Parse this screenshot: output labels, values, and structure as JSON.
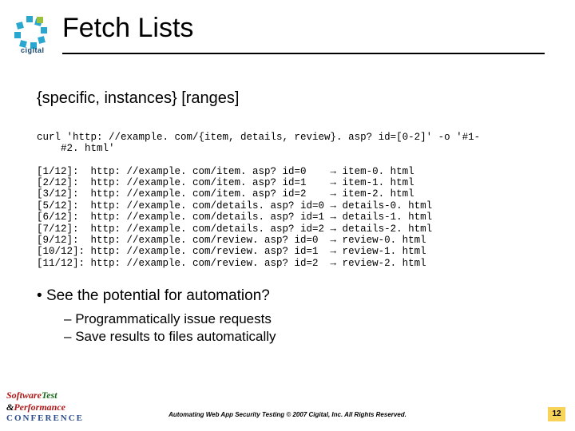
{
  "brand": {
    "name": "cigital",
    "logo_color_primary": "#2aa7cf",
    "logo_color_accent": "#9ac23c"
  },
  "title": "Fetch Lists",
  "subtitle": "{specific, instances} [ranges]",
  "code": {
    "cmd": "curl 'http: //example. com/{item, details, review}. asp? id=[0-2]' -o '#1-\n    #2. html'",
    "rows": [
      {
        "idx": "[1/12]:",
        "url": "http: //example. com/item. asp? id=0",
        "arrow": "→",
        "out": "item-0. html"
      },
      {
        "idx": "[2/12]:",
        "url": "http: //example. com/item. asp? id=1",
        "arrow": "→",
        "out": "item-1. html"
      },
      {
        "idx": "[3/12]:",
        "url": "http: //example. com/item. asp? id=2",
        "arrow": "→",
        "out": "item-2. html"
      },
      {
        "idx": "[5/12]:",
        "url": "http: //example. com/details. asp? id=0",
        "arrow": "→",
        "out": "details-0. html"
      },
      {
        "idx": "[6/12]:",
        "url": "http: //example. com/details. asp? id=1",
        "arrow": "→",
        "out": "details-1. html"
      },
      {
        "idx": "[7/12]:",
        "url": "http: //example. com/details. asp? id=2",
        "arrow": "→",
        "out": "details-2. html"
      },
      {
        "idx": "[9/12]:",
        "url": "http: //example. com/review. asp? id=0",
        "arrow": "→",
        "out": "review-0. html"
      },
      {
        "idx": "[10/12]:",
        "url": "http: //example. com/review. asp? id=1",
        "arrow": "→",
        "out": "review-1. html"
      },
      {
        "idx": "[11/12]:",
        "url": "http: //example. com/review. asp? id=2",
        "arrow": "→",
        "out": "review-2. html"
      }
    ]
  },
  "bullets": {
    "b1": "See the potential for automation?",
    "b2a": "Programmatically issue requests",
    "b2b": "Save results to files automatically"
  },
  "footer": {
    "text": "Automating Web App Security Testing  © 2007 Cigital, Inc. All Rights Reserved.",
    "page": "12",
    "conf_brand_1a": "Software",
    "conf_brand_1b": "Test",
    "conf_brand_amp": "&",
    "conf_brand_2": "Performance",
    "conf_brand_3": "CONFERENCE"
  }
}
